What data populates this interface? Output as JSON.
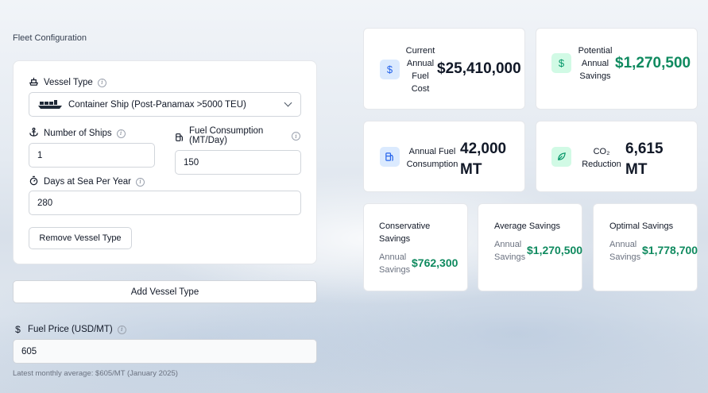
{
  "fleet": {
    "title": "Fleet Configuration",
    "vessel_type_label": "Vessel Type",
    "vessel_type_value": "Container Ship (Post-Panamax >5000 TEU)",
    "num_ships_label": "Number of Ships",
    "num_ships_value": "1",
    "fuel_consumption_label_line1": "Fuel Consumption",
    "fuel_consumption_label_line2": "(MT/Day)",
    "fuel_consumption_value": "150",
    "days_at_sea_label": "Days at Sea Per Year",
    "days_at_sea_value": "280",
    "remove_vessel_label": "Remove Vessel Type",
    "add_vessel_label": "Add Vessel Type",
    "fuel_price_label": "Fuel Price (USD/MT)",
    "fuel_price_value": "605",
    "fuel_price_note": "Latest monthly average: $605/MT (January 2025)"
  },
  "stats": {
    "current_cost": {
      "label_lines": [
        "Current",
        "Annual",
        "Fuel",
        "Cost"
      ],
      "value": "$25,410,000",
      "icon": "dollar-icon",
      "icon_bg": "#dbeafe",
      "icon_color": "#2563eb"
    },
    "potential_savings": {
      "label_lines": [
        "Potential",
        "Annual",
        "Savings"
      ],
      "value": "$1,270,500",
      "icon": "dollar-icon",
      "icon_bg": "#d1fae5",
      "icon_color": "#059669"
    },
    "annual_consumption": {
      "label_lines": [
        "Annual Fuel",
        "Consumption"
      ],
      "value_line1": "42,000",
      "value_line2": "MT",
      "icon": "fuel-pump-icon",
      "icon_bg": "#dbeafe",
      "icon_color": "#2563eb"
    },
    "co2_reduction": {
      "label_lines": [
        "CO₂",
        "Reduction"
      ],
      "value_line1": "6,615",
      "value_line2": "MT",
      "icon": "leaf-icon",
      "icon_bg": "#d1fae5",
      "icon_color": "#059669"
    }
  },
  "scenarios": [
    {
      "title_lines": [
        "Conservative",
        "Savings"
      ],
      "sub_lines": [
        "Annual",
        "Savings"
      ],
      "value": "$762,300"
    },
    {
      "title_lines": [
        "Average Savings"
      ],
      "sub_lines": [
        "Annual",
        "Savings"
      ],
      "value": "$1,270,500"
    },
    {
      "title_lines": [
        "Optimal Savings"
      ],
      "sub_lines": [
        "Annual",
        "Savings"
      ],
      "value": "$1,778,700"
    }
  ]
}
